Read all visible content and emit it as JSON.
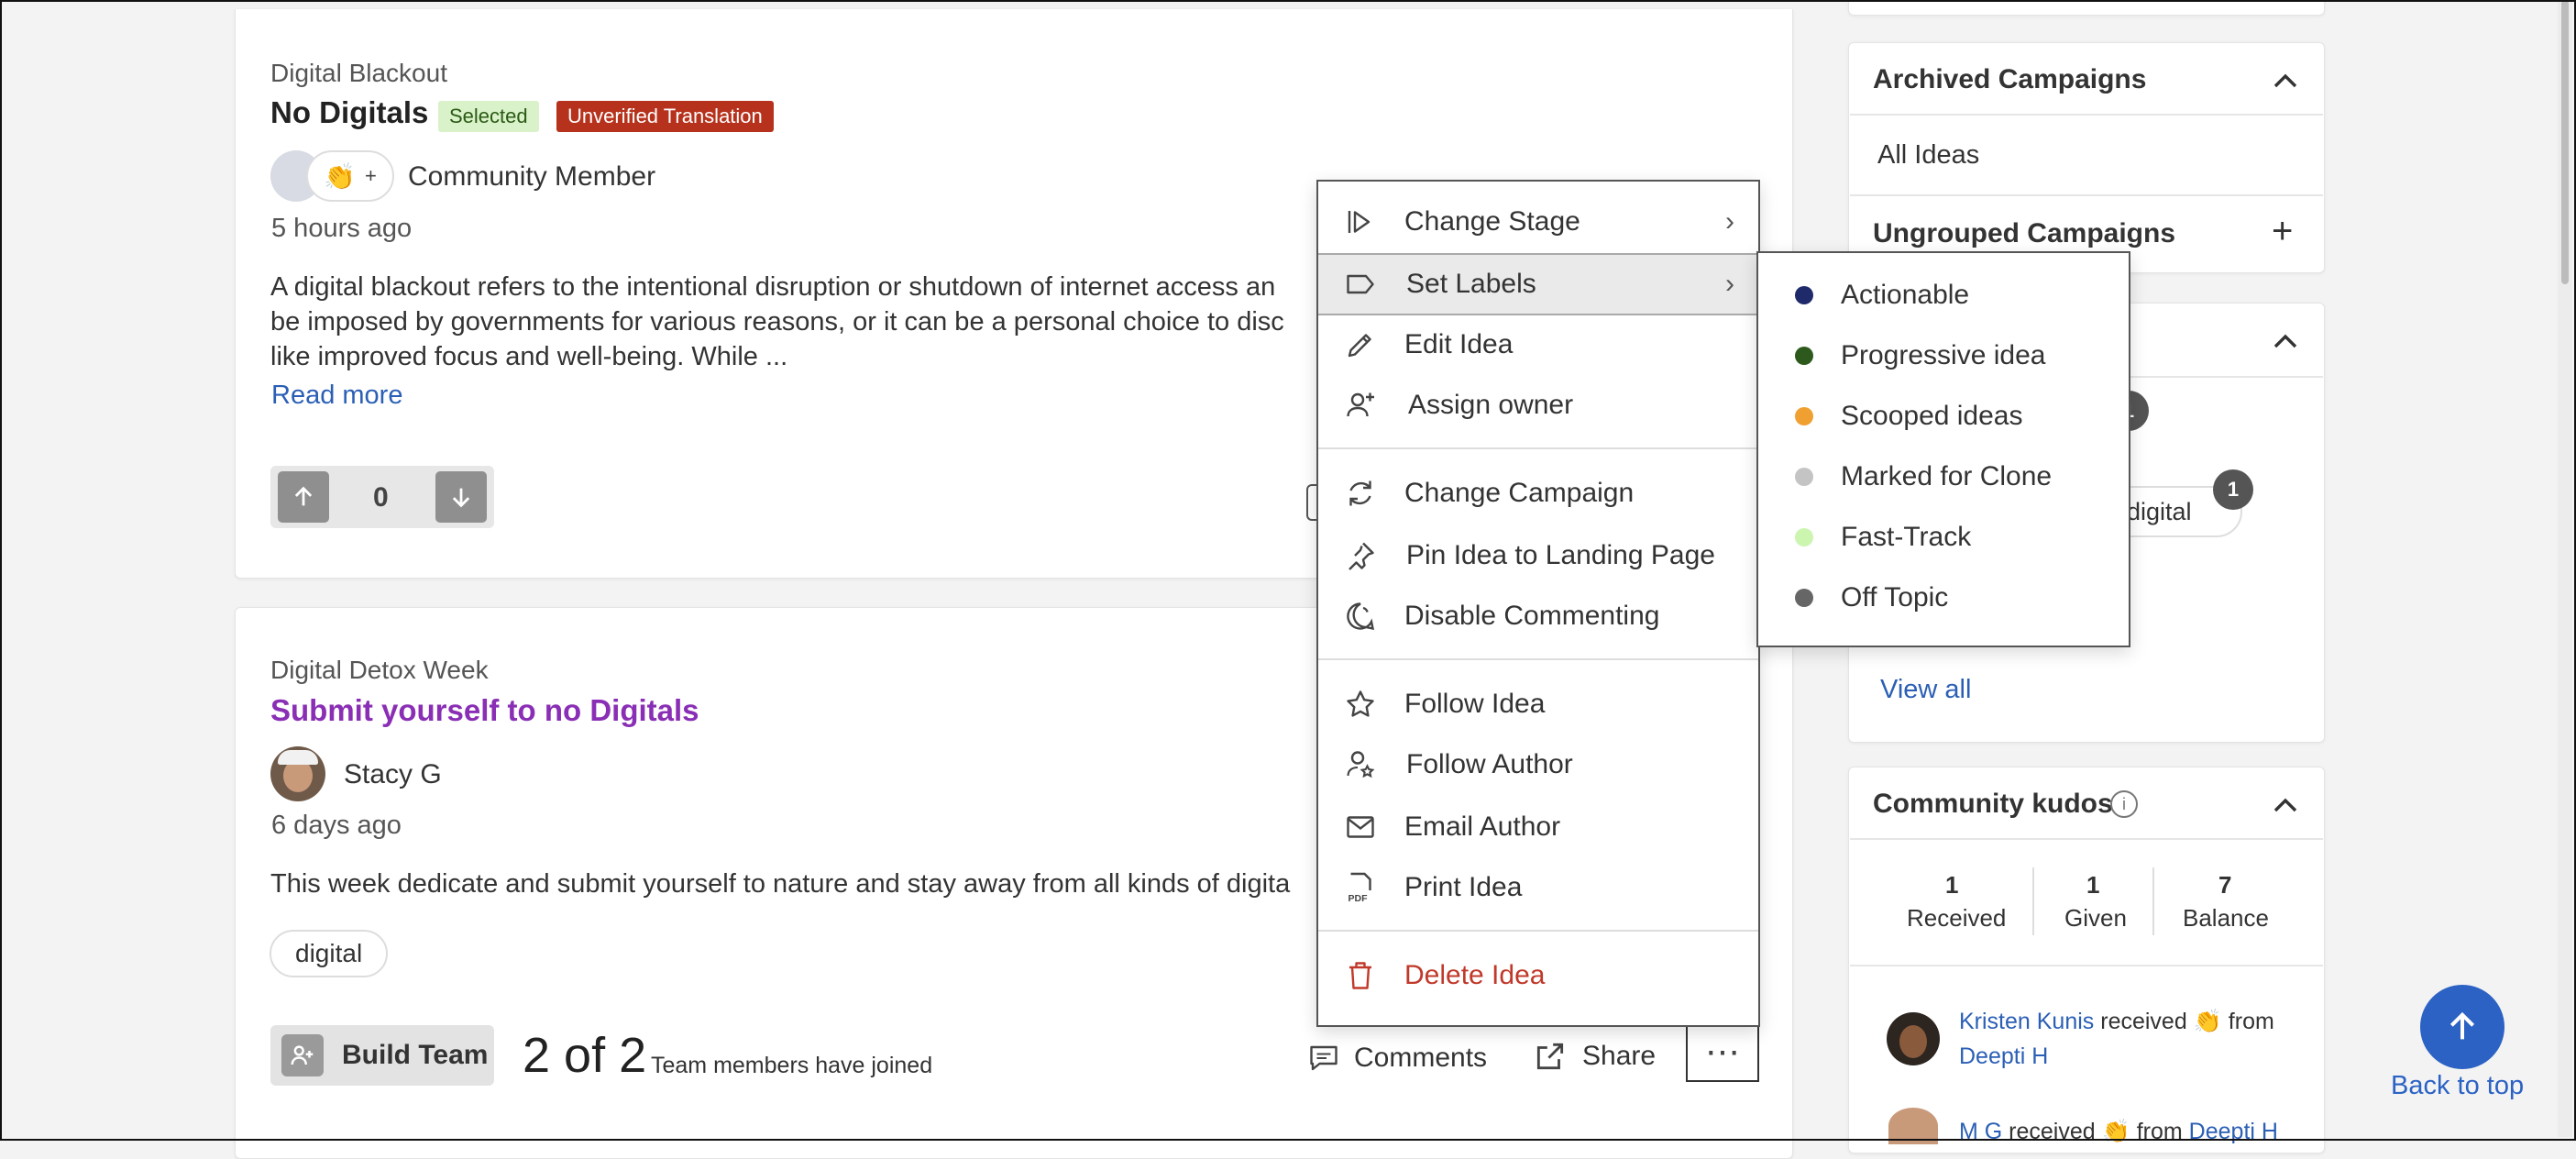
{
  "idea1": {
    "campaign": "Digital Blackout",
    "title": "No Digitals",
    "badge_selected": "Selected",
    "badge_unverified": "Unverified Translation",
    "reaction_plus": "+",
    "author": "Community Member",
    "time": "5 hours ago",
    "body_line1": "A digital blackout refers to the intentional disruption or shutdown of internet access an",
    "body_line2": "be imposed by governments for various reasons, or it can be a personal choice to disc",
    "body_line3": "like improved focus and well-being. While ...",
    "read_more": "Read more",
    "votes": "0"
  },
  "idea2": {
    "campaign": "Digital Detox Week",
    "title": "Submit yourself to no Digitals",
    "author": "Stacy G",
    "time": "6 days ago",
    "body": "This week dedicate and submit yourself to nature and stay away from all kinds of digita",
    "tag": "digital",
    "build_team": "Build Team",
    "team_count": "2 of 2",
    "team_text": "Team members have joined",
    "comments": "Comments",
    "share": "Share",
    "more": "⋯"
  },
  "menu": {
    "items": [
      {
        "label": "Change Stage",
        "icon": "skip-forward-icon"
      },
      {
        "label": "Set Labels",
        "icon": "label-icon"
      },
      {
        "label": "Edit Idea",
        "icon": "pencil-icon"
      },
      {
        "label": "Assign owner",
        "icon": "user-plus-icon"
      },
      {
        "label": "Change Campaign",
        "icon": "refresh-icon"
      },
      {
        "label": "Pin Idea to Landing Page",
        "icon": "pin-icon"
      },
      {
        "label": "Disable Commenting",
        "icon": "comment-off-icon"
      },
      {
        "label": "Follow Idea",
        "icon": "star-icon"
      },
      {
        "label": "Follow Author",
        "icon": "user-star-icon"
      },
      {
        "label": "Email Author",
        "icon": "mail-icon"
      },
      {
        "label": "Print Idea",
        "icon": "pdf-icon"
      },
      {
        "label": "Delete Idea",
        "icon": "trash-icon"
      }
    ],
    "delete_color": "#c0392b"
  },
  "labels_submenu": [
    {
      "label": "Actionable",
      "color": "#1f2a6b"
    },
    {
      "label": "Progressive idea",
      "color": "#2d5a1c"
    },
    {
      "label": "Scooped ideas",
      "color": "#f0a030"
    },
    {
      "label": "Marked for Clone",
      "color": "#c4c4c4"
    },
    {
      "label": "Fast-Track",
      "color": "#ccf5b0"
    },
    {
      "label": "Off Topic",
      "color": "#666666"
    }
  ],
  "sidebar": {
    "archived_title": "Archived Campaigns",
    "all_ideas": "All Ideas",
    "ungrouped_title": "Ungrouped Campaigns",
    "tag_partial": "n-digital",
    "tag_count_1": "1",
    "tag_count_2": "1",
    "view_all": "View all",
    "kudos_title": "Community kudos",
    "kudos": [
      {
        "value": "1",
        "label": "Received"
      },
      {
        "value": "1",
        "label": "Given"
      },
      {
        "value": "7",
        "label": "Balance"
      }
    ],
    "kudos_feed": {
      "name1": "Kristen Kunis",
      "received": "received",
      "from": "from",
      "giver1": "Deepti H",
      "name2": "M G",
      "received2": "received",
      "from2": "from",
      "giver2": "Deepti H"
    }
  },
  "back_to_top": "Back to top",
  "colors": {
    "accent": "#2b5fb5",
    "title_purple": "#8a2fb5",
    "delete_red": "#c0392b",
    "back_to_top": "#2b62c4"
  }
}
